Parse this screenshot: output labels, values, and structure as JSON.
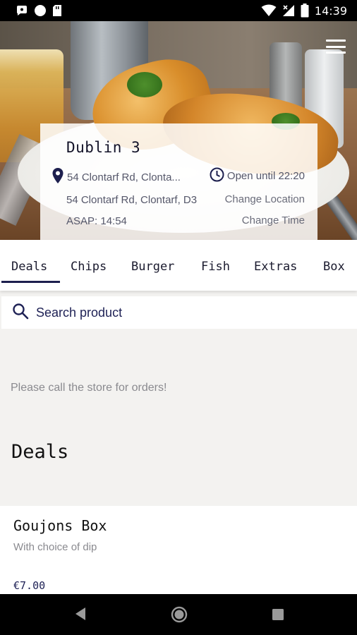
{
  "status_bar": {
    "time": "14:39"
  },
  "store": {
    "name": "Dublin 3",
    "address_short": "54 Clontarf Rd, Clonta...",
    "hours": "Open until 22:20",
    "address_full": "54 Clontarf Rd, Clontarf, D3",
    "change_location_label": "Change Location",
    "asap": "ASAP: 14:54",
    "change_time_label": "Change Time"
  },
  "tabs": [
    {
      "label": "Deals",
      "active": true
    },
    {
      "label": "Chips"
    },
    {
      "label": "Burger"
    },
    {
      "label": "Fish"
    },
    {
      "label": "Extras"
    },
    {
      "label": "Box"
    }
  ],
  "search": {
    "placeholder": "Search product"
  },
  "notice": "Please call the store for orders!",
  "section": {
    "title": "Deals"
  },
  "products": [
    {
      "name": "Goujons Box",
      "description": "With choice of dip",
      "price": "€7.00"
    }
  ],
  "colors": {
    "accent": "#1d1f4e",
    "card_bg": "#ffffff",
    "page_bg": "#f3f2f0"
  },
  "icons": [
    "message-icon",
    "circle-icon",
    "sd-card-icon",
    "wifi-icon",
    "signal-icon",
    "battery-icon",
    "menu-icon",
    "location-pin-icon",
    "clock-icon",
    "search-icon",
    "back-icon",
    "home-icon",
    "recents-icon"
  ]
}
